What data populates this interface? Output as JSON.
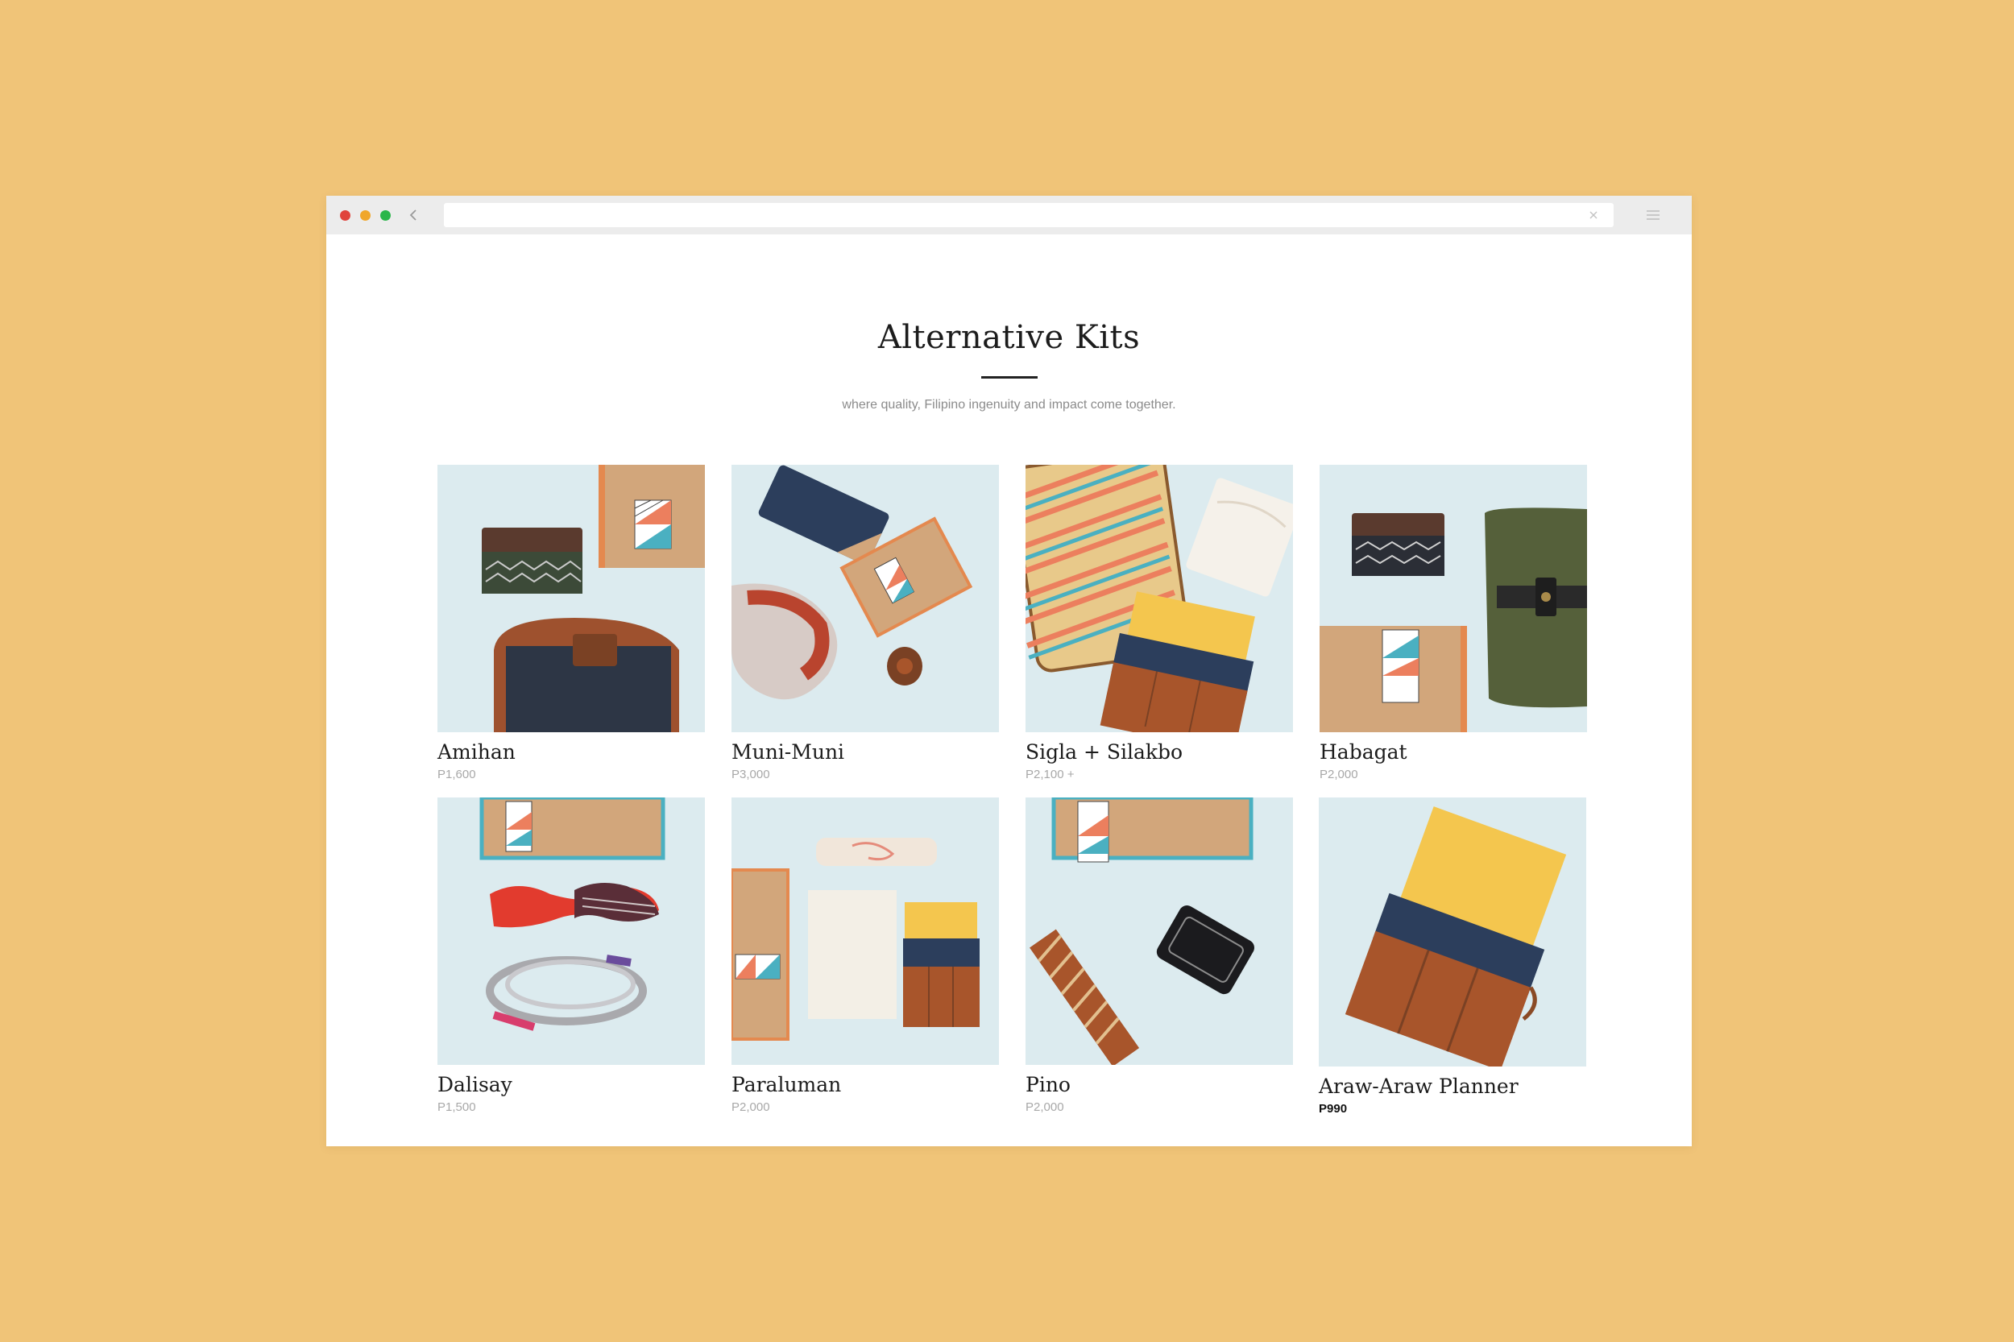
{
  "page": {
    "title": "Alternative Kits",
    "subtitle": "where quality, Filipino ingenuity and impact come together."
  },
  "browser": {
    "url": ""
  },
  "products": [
    {
      "name": "Amihan",
      "price": "P1,600"
    },
    {
      "name": "Muni-Muni",
      "price": "P3,000"
    },
    {
      "name": "Sigla + Silakbo",
      "price": "P2,100 +"
    },
    {
      "name": "Habagat",
      "price": "P2,000"
    },
    {
      "name": "Dalisay",
      "price": "P1,500"
    },
    {
      "name": "Paraluman",
      "price": "P2,000"
    },
    {
      "name": "Pino",
      "price": "P2,000"
    },
    {
      "name": "Araw-Araw Planner",
      "price": "P990"
    }
  ],
  "icons": {
    "back": "chevron-left-icon",
    "close": "close-icon",
    "menu": "hamburger-menu-icon"
  },
  "colors": {
    "background": "#F0C478",
    "photo_bg": "#DCEBEF",
    "kraft_box": "#D2A67B",
    "teal": "#4AB0C1",
    "coral": "#EC7F5E",
    "navy": "#2C3E5C",
    "mustard": "#F4C64E",
    "leather": "#A8552B",
    "olive": "#5A6634"
  }
}
